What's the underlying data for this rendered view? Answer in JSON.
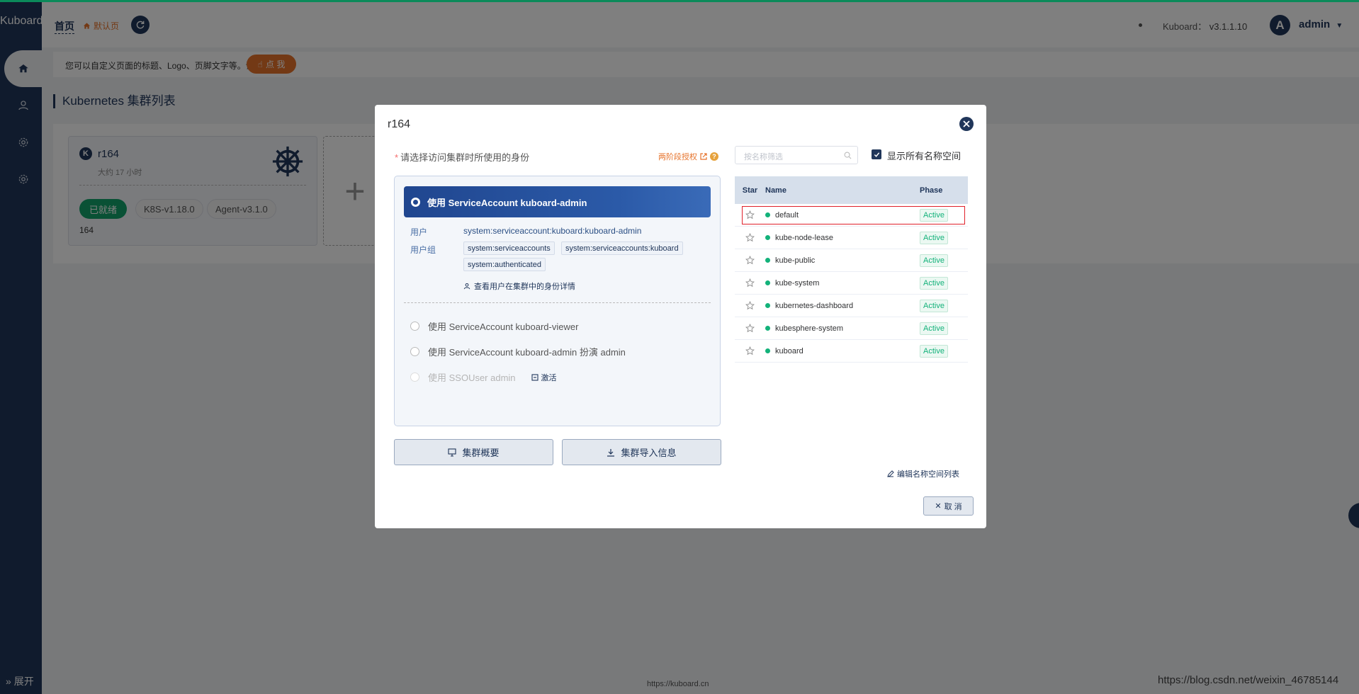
{
  "app": {
    "brand": "Kuboard",
    "expand_label": "展开"
  },
  "header": {
    "home": "首页",
    "default_page": "默认页",
    "version_label": "Kuboard：",
    "version": "v3.1.1.10",
    "avatar_letter": "A",
    "username": "admin"
  },
  "notice": {
    "text": "您可以自定义页面的标题、Logo、页脚文字等。请",
    "button": "点 我"
  },
  "page_title": "Kubernetes 集群列表",
  "cluster": {
    "icon_letter": "K",
    "name": "r164",
    "age": "大约 17 小时",
    "status": "已就绪",
    "k8s_version": "K8S-v1.18.0",
    "agent_version": "Agent-v3.1.0",
    "description": "164"
  },
  "modal": {
    "title": "r164",
    "identity_label": "请选择访问集群时所使用的身份",
    "two_step_link": "两阶段授权",
    "help": "?",
    "selected_option": "使用 ServiceAccount kuboard-admin",
    "user_label": "用户",
    "user_value": "system:serviceaccount:kuboard:kuboard-admin",
    "group_label": "用户组",
    "groups": [
      "system:serviceaccounts",
      "system:serviceaccounts:kuboard",
      "system:authenticated"
    ],
    "view_detail": "查看用户在集群中的身份详情",
    "options": [
      "使用 ServiceAccount kuboard-viewer",
      "使用 ServiceAccount kuboard-admin 扮演 admin"
    ],
    "sso_option": "使用 SSOUser admin",
    "activate": "激活",
    "overview_button": "集群概要",
    "import_button": "集群导入信息",
    "search_placeholder": "按名称筛选",
    "show_all_ns": "显示所有名称空间",
    "table_headers": {
      "star": "Star",
      "name": "Name",
      "phase": "Phase"
    },
    "namespaces": [
      {
        "name": "default",
        "phase": "Active"
      },
      {
        "name": "kube-node-lease",
        "phase": "Active"
      },
      {
        "name": "kube-public",
        "phase": "Active"
      },
      {
        "name": "kube-system",
        "phase": "Active"
      },
      {
        "name": "kubernetes-dashboard",
        "phase": "Active"
      },
      {
        "name": "kubesphere-system",
        "phase": "Active"
      },
      {
        "name": "kuboard",
        "phase": "Active"
      }
    ],
    "edit_ns_list": "编辑名称空间列表",
    "cancel": "取 消"
  },
  "footer": {
    "link": "https://kuboard.cn",
    "watermark": "https://blog.csdn.net/weixin_46785144"
  },
  "colors": {
    "primary": "#20365a",
    "accent": "#e6722a",
    "success": "#13a36a",
    "highlight": "#e0202a"
  }
}
